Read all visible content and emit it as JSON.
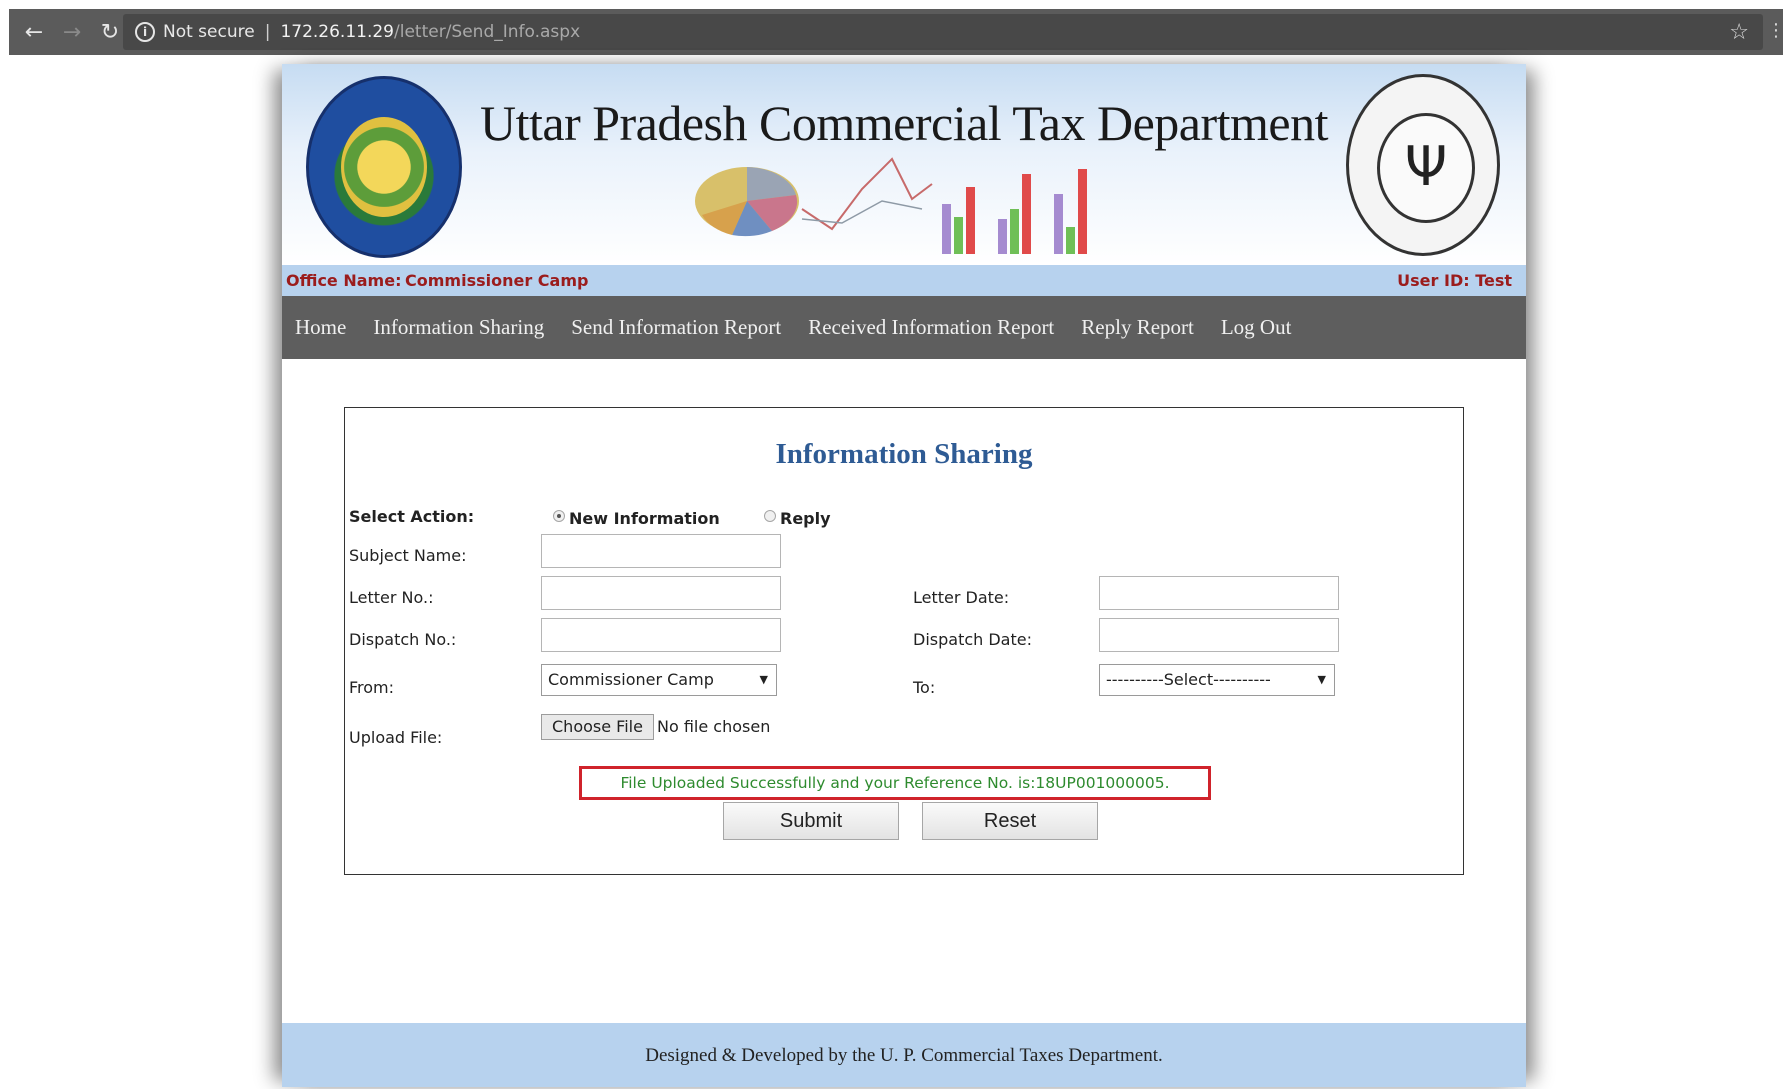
{
  "browser": {
    "security_label": "Not secure",
    "url_host": "172.26.11.29",
    "url_path": "/letter/Send_Info.aspx"
  },
  "header": {
    "title": "Uttar Pradesh Commercial Tax Department"
  },
  "info_strip": {
    "office_label": "Office Name:",
    "office_value": "Commissioner Camp",
    "user_id": "User ID: Test"
  },
  "nav": {
    "items": [
      "Home",
      "Information Sharing",
      "Send Information Report",
      "Received Information Report",
      "Reply Report",
      "Log Out"
    ]
  },
  "form": {
    "title": "Information Sharing",
    "select_action_label": "Select Action:",
    "option_new": "New Information",
    "option_reply": "Reply",
    "selected_action": "New Information",
    "subject_label": "Subject Name:",
    "letter_no_label": "Letter No.:",
    "letter_date_label": "Letter Date:",
    "dispatch_no_label": "Dispatch No.:",
    "dispatch_date_label": "Dispatch Date:",
    "from_label": "From:",
    "from_value": "Commissioner Camp",
    "to_label": "To:",
    "to_value": "----------Select----------",
    "upload_label": "Upload File:",
    "choose_file": "Choose File",
    "no_file": "No file chosen",
    "success_message": "File Uploaded Successfully and your Reference No. is:18UP001000005.",
    "submit_label": "Submit",
    "reset_label": "Reset"
  },
  "footer": {
    "text": "Designed & Developed by the U. P. Commercial Taxes Department."
  },
  "colors": {
    "success": "#2e8b2e",
    "error_border": "#d0232b",
    "title": "#2e5b94",
    "office": "#9b1c1c"
  }
}
